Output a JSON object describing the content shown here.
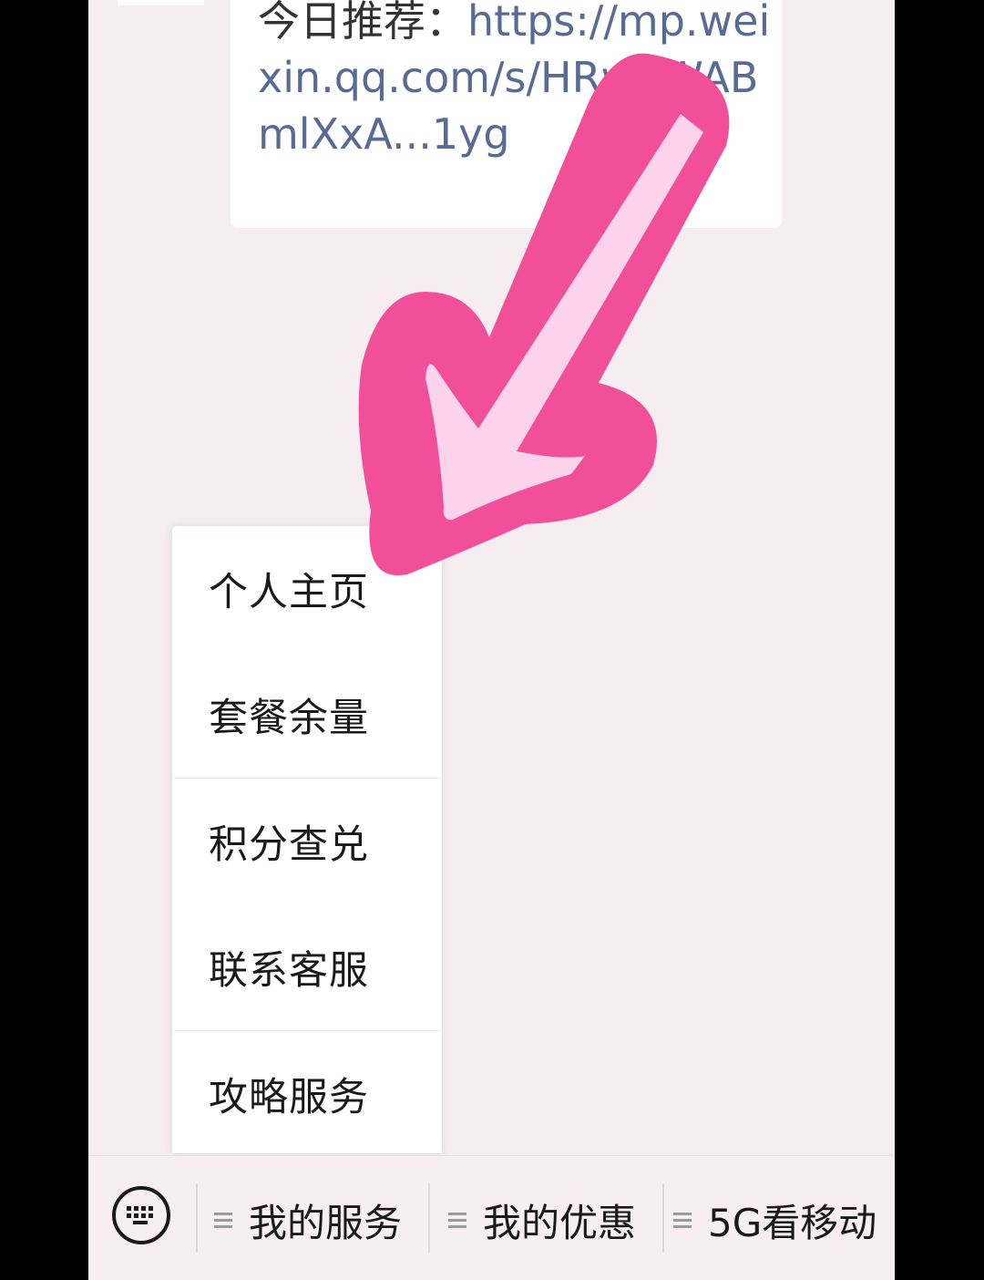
{
  "message": {
    "prefix": "今日推荐：",
    "link": "https://mp.weixin.qq.com/s/HRwgWABmlXxA...1yg"
  },
  "menu": {
    "items": [
      "个人主页",
      "套餐余量",
      "积分查兑",
      "联系客服",
      "攻略服务"
    ]
  },
  "bottom_bar": {
    "keyboard_icon": "keyboard-icon",
    "tabs": [
      "我的服务",
      "我的优惠",
      "5G看移动"
    ],
    "tab_icon": "menu-lines-icon"
  },
  "colors": {
    "arrow_outer": "#f24f9a",
    "arrow_inner": "#fcd3ea",
    "link": "#576b95",
    "background": "#f6edf1"
  }
}
